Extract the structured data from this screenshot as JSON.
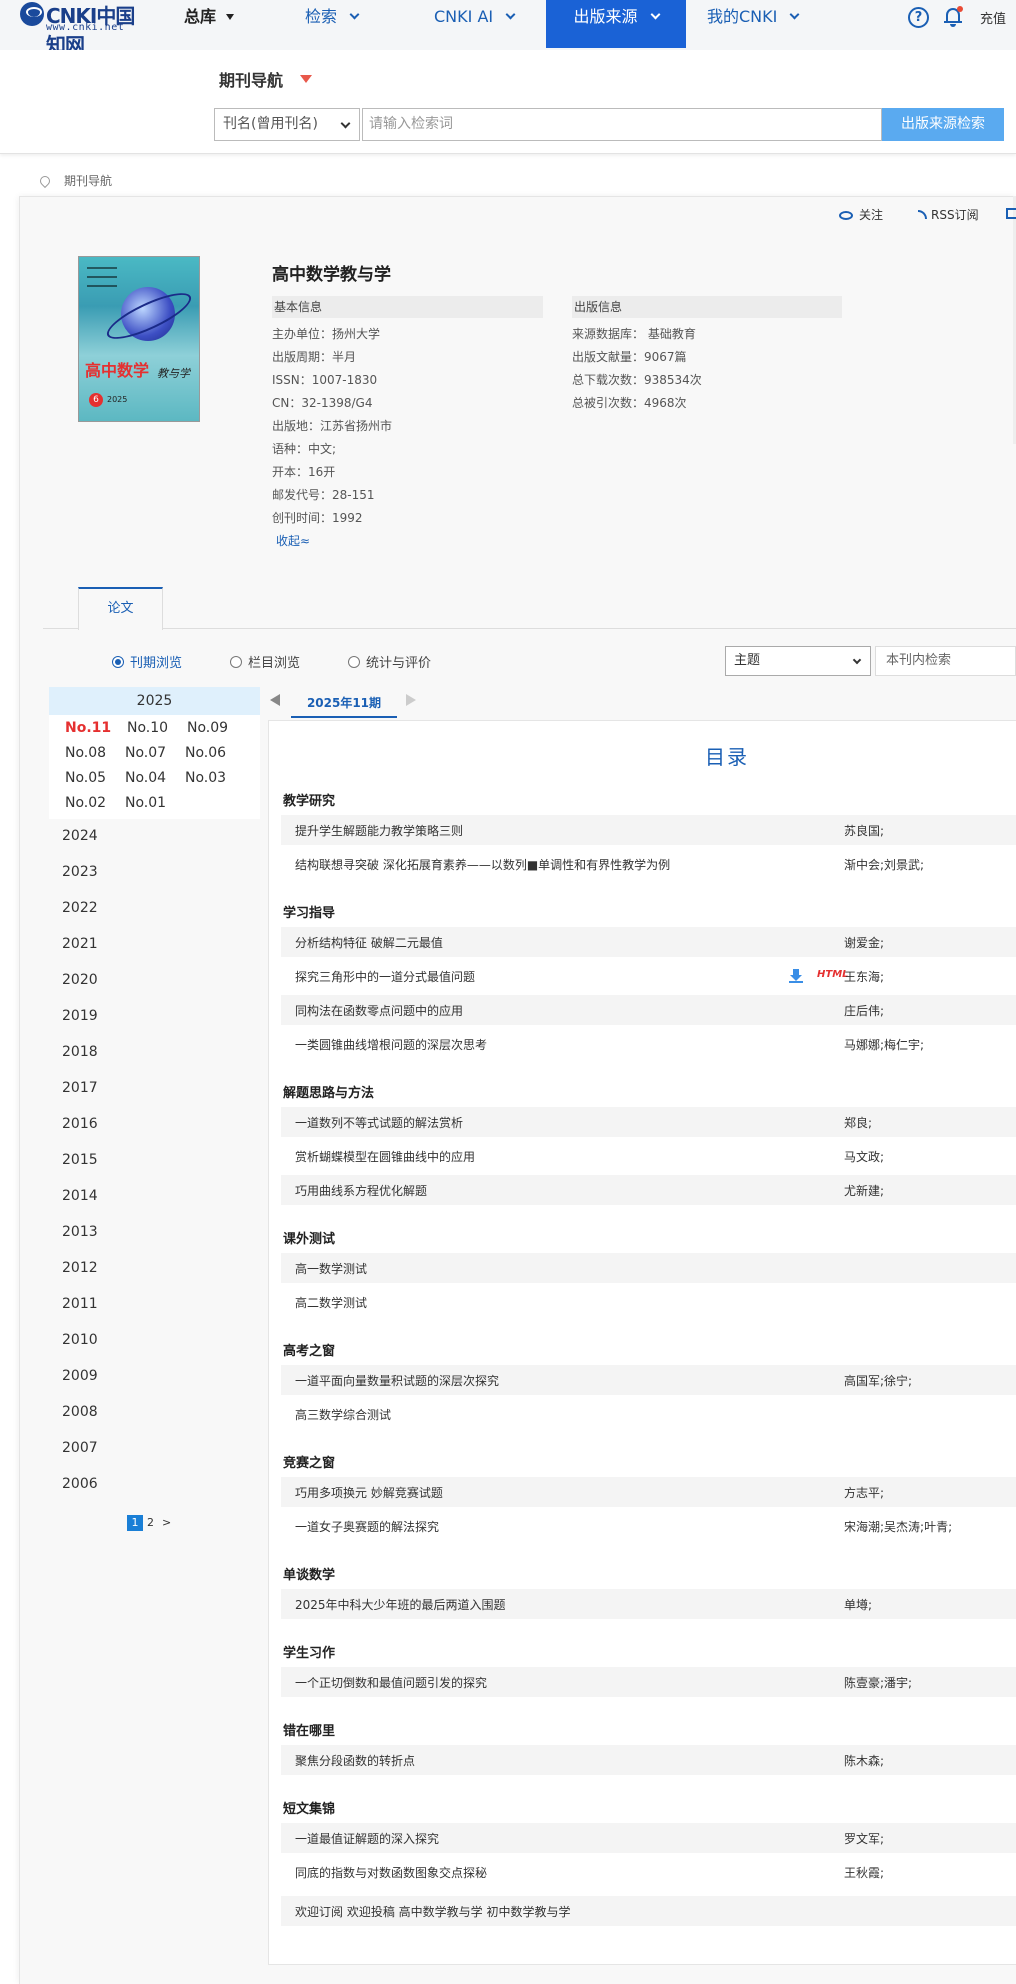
{
  "header": {
    "logo_text": "CNKI中国知网",
    "logo_url": "www.cnki.net",
    "nav": [
      {
        "label": "总库"
      },
      {
        "label": "检索"
      },
      {
        "label": "CNKI AI"
      },
      {
        "label": "出版来源"
      },
      {
        "label": "我的CNKI"
      }
    ],
    "help_symbol": "?",
    "recharge": "充值"
  },
  "search": {
    "nav_title": "期刊导航",
    "field": "刊名(曾用刊名)",
    "placeholder": "请输入检索词",
    "button": "出版来源检索"
  },
  "breadcrumb": "期刊导航",
  "actions": {
    "follow": "关注",
    "rss": "RSS订阅"
  },
  "journal": {
    "title": "高中数学教与学",
    "cover_title": "高中数学",
    "cover_subtitle": "教与学",
    "cover_issue": "6",
    "cover_year": "2025",
    "basic_head": "基本信息",
    "pub_head": "出版信息",
    "basic": [
      "主办单位：扬州大学",
      "出版周期：半月",
      "ISSN：1007-1830",
      "CN：32-1398/G4",
      "出版地：江苏省扬州市",
      "语种：中文;",
      "开本：16开",
      "邮发代号：28-151",
      "创刊时间：1992"
    ],
    "pub": [
      "来源数据库： 基础教育",
      "出版文献量：9067篇",
      "总下载次数：938534次",
      "总被引次数：4968次"
    ],
    "collapse": "收起≈"
  },
  "tabs": {
    "paper": "论文"
  },
  "browse": {
    "options": [
      "刊期浏览",
      "栏目浏览",
      "统计与评价"
    ],
    "topic": "主题",
    "inner_search": "本刊内检索"
  },
  "years": {
    "current": "2025",
    "issues": [
      "No.11",
      "No.10",
      "No.09",
      "No.08",
      "No.07",
      "No.06",
      "No.05",
      "No.04",
      "No.03",
      "No.02",
      "No.01"
    ],
    "list": [
      "2024",
      "2023",
      "2022",
      "2021",
      "2020",
      "2019",
      "2018",
      "2017",
      "2016",
      "2015",
      "2014",
      "2013",
      "2012",
      "2011",
      "2010",
      "2009",
      "2008",
      "2007",
      "2006"
    ],
    "pages": [
      "1",
      "2",
      ">"
    ]
  },
  "issue_strip": {
    "current": "2025年11期"
  },
  "toc": {
    "title": "目录",
    "html_label": "HTML",
    "sections": [
      {
        "name": "教学研究",
        "articles": [
          {
            "title": "提升学生解题能力教学策略三则",
            "authors": "苏良国;"
          },
          {
            "title": "结构联想寻突破 深化拓展育素养——以数列■单调性和有界性教学为例",
            "authors": "渐中会;刘景武;"
          }
        ]
      },
      {
        "name": "学习指导",
        "articles": [
          {
            "title": "分析结构特征 破解二元最值",
            "authors": "谢爱金;"
          },
          {
            "title": "探究三角形中的一道分式最值问题",
            "authors": "王东海;"
          },
          {
            "title": "同构法在函数零点问题中的应用",
            "authors": "庄后伟;"
          },
          {
            "title": "一类圆锥曲线增根问题的深层次思考",
            "authors": "马娜娜;梅仁宇;"
          }
        ]
      },
      {
        "name": "解题思路与方法",
        "articles": [
          {
            "title": "一道数列不等式试题的解法赏析",
            "authors": "郑良;"
          },
          {
            "title": "赏析蝴蝶模型在圆锥曲线中的应用",
            "authors": "马文政;"
          },
          {
            "title": "巧用曲线系方程优化解题",
            "authors": "尤新建;"
          }
        ]
      },
      {
        "name": "课外测试",
        "articles": [
          {
            "title": "高一数学测试",
            "authors": ""
          },
          {
            "title": "高二数学测试",
            "authors": ""
          }
        ]
      },
      {
        "name": "高考之窗",
        "articles": [
          {
            "title": "一道平面向量数量积试题的深层次探究",
            "authors": "高国军;徐宁;"
          },
          {
            "title": "高三数学综合测试",
            "authors": ""
          }
        ]
      },
      {
        "name": "竞赛之窗",
        "articles": [
          {
            "title": "巧用多项换元 妙解竞赛试题",
            "authors": "方志平;"
          },
          {
            "title": "一道女子奥赛题的解法探究",
            "authors": "宋海潮;吴杰涛;叶青;"
          }
        ]
      },
      {
        "name": "单谈数学",
        "articles": [
          {
            "title": "2025年中科大少年班的最后两道入围题",
            "authors": "单墫;"
          }
        ]
      },
      {
        "name": "学生习作",
        "articles": [
          {
            "title": "一个正切倒数和最值问题引发的探究",
            "authors": "陈壹豪;潘宇;"
          }
        ]
      },
      {
        "name": "错在哪里",
        "articles": [
          {
            "title": "聚焦分段函数的转折点",
            "authors": "陈木森;"
          }
        ]
      },
      {
        "name": "短文集锦",
        "articles": [
          {
            "title": "一道最值证解题的深入探究",
            "authors": "罗文军;"
          },
          {
            "title": "同底的指数与对数函数图象交点探秘",
            "authors": "王秋霞;"
          }
        ]
      }
    ],
    "footer": "欢迎订阅 欢迎投稿 高中数学教与学 初中数学教与学"
  }
}
